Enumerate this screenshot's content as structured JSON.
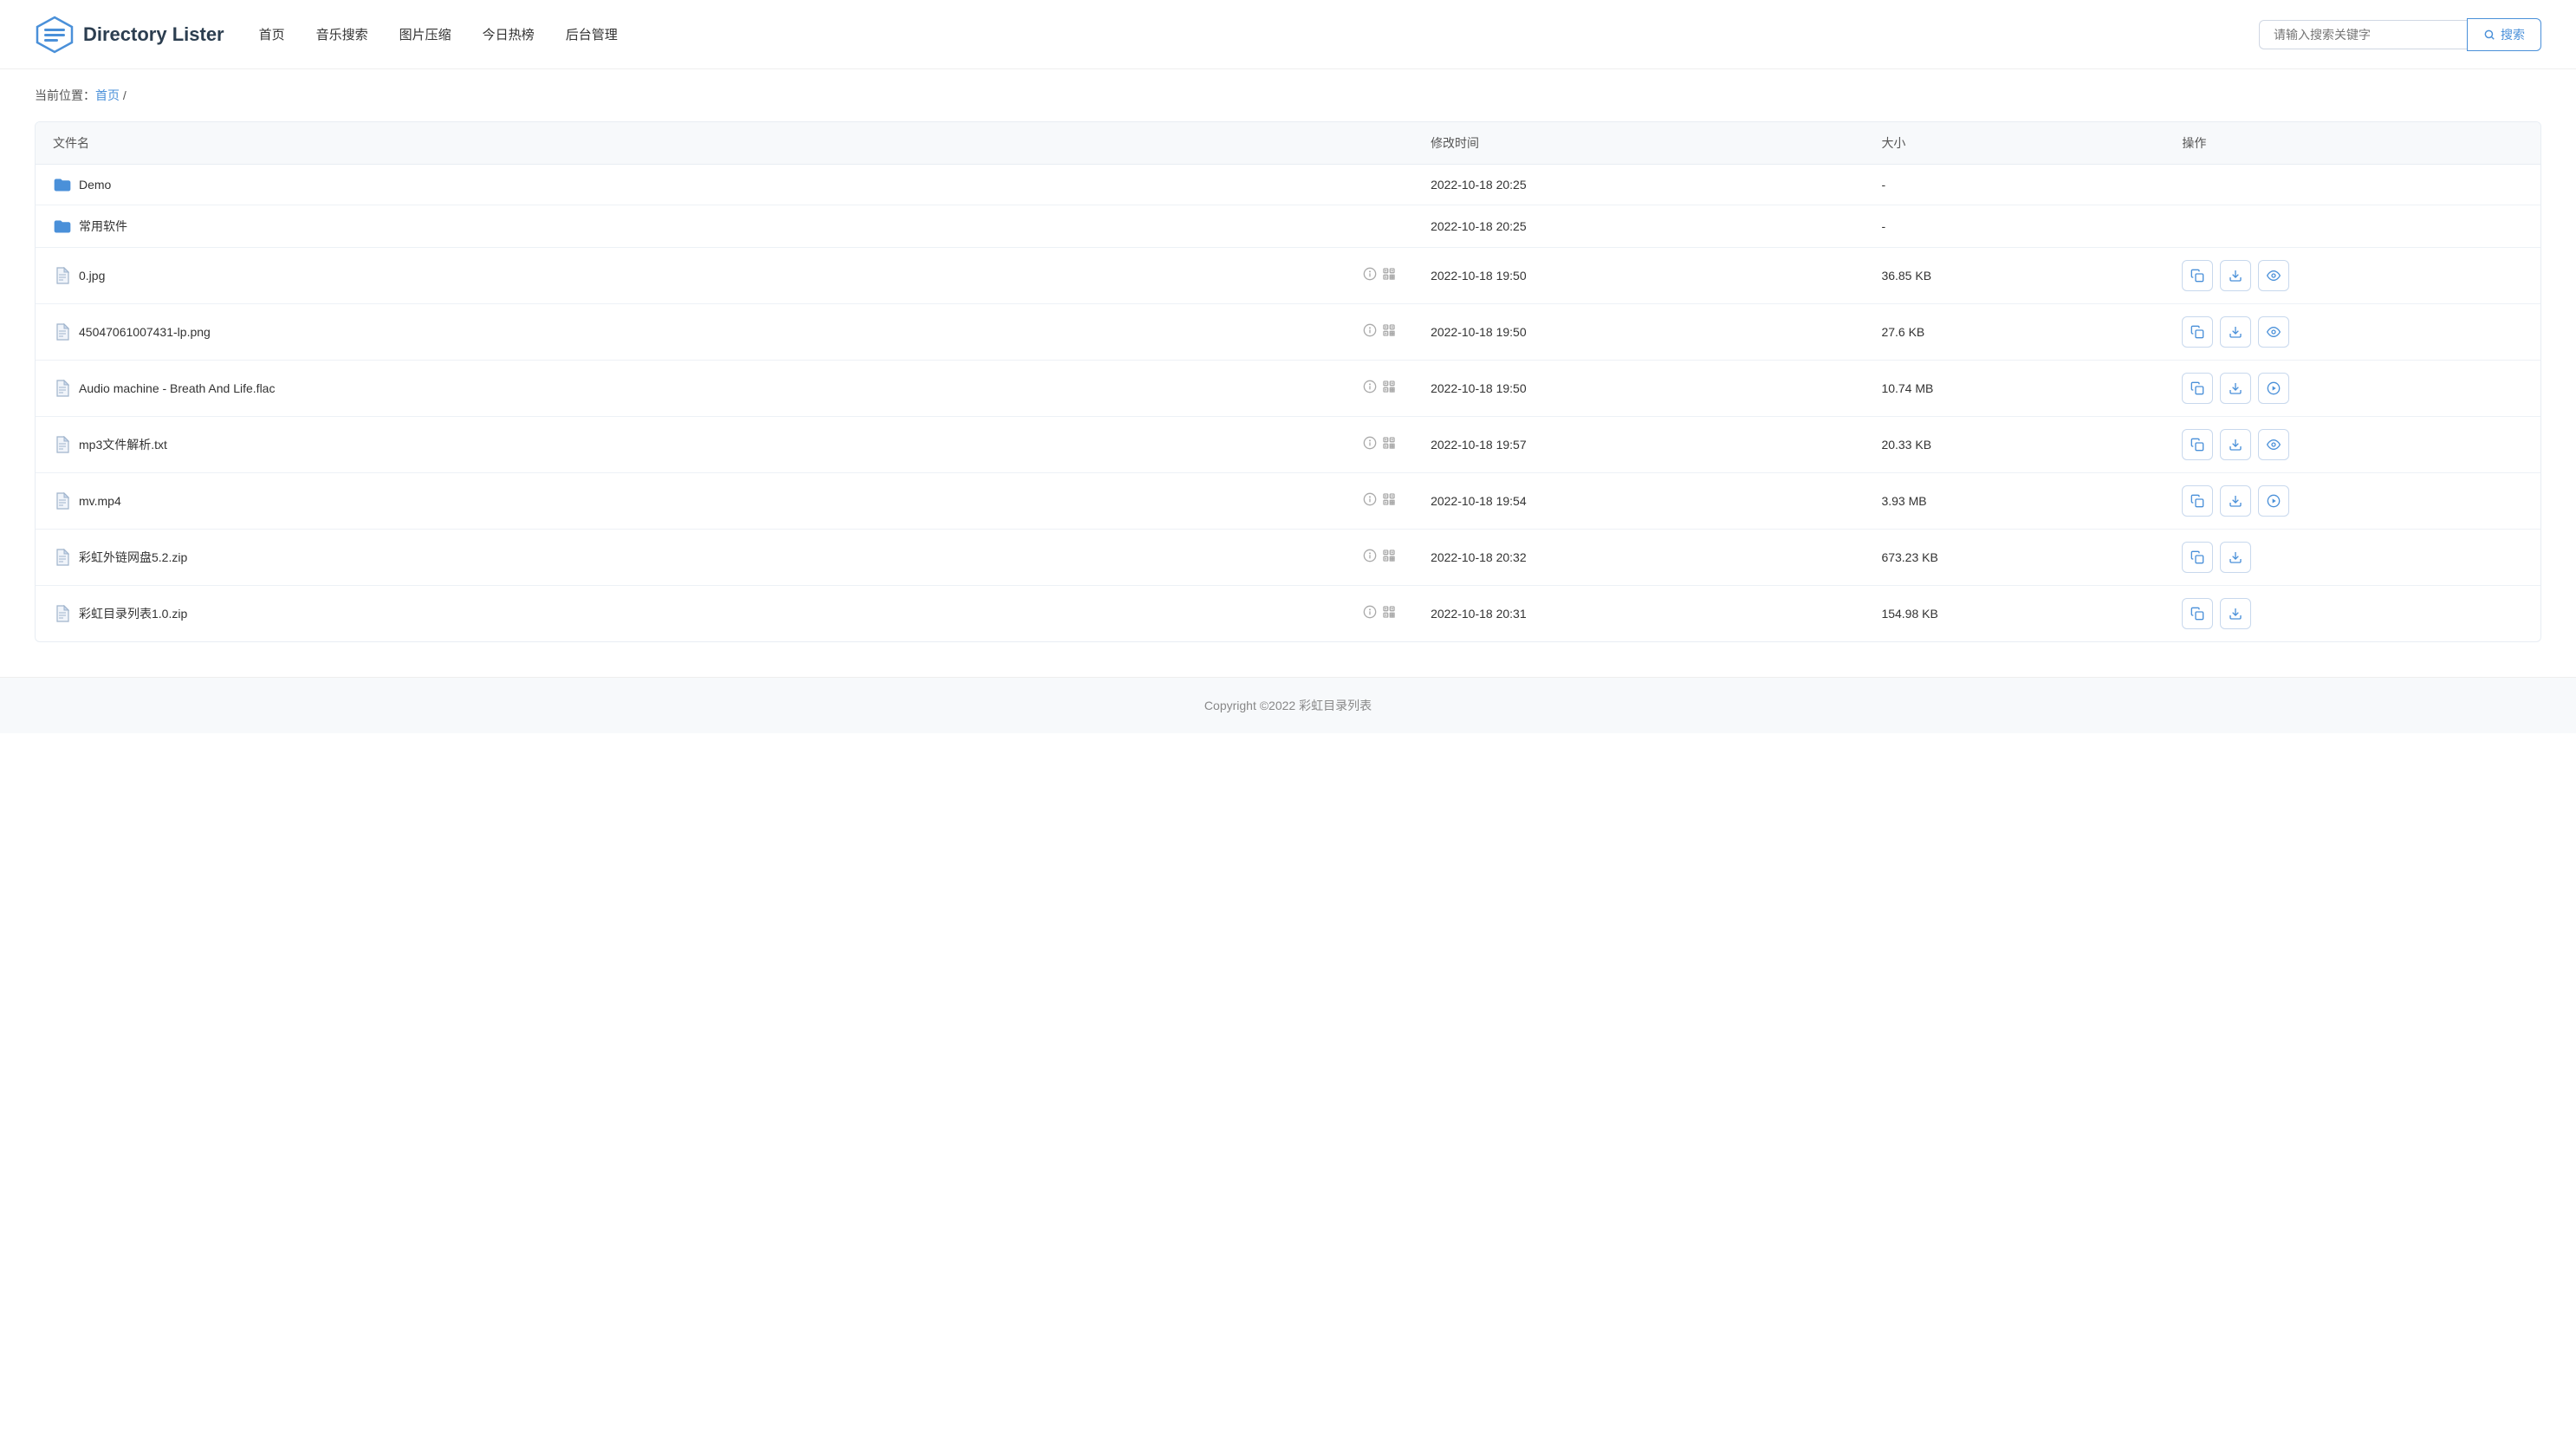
{
  "header": {
    "logo_text": "Directory Lister",
    "nav": [
      {
        "label": "首页",
        "key": "home"
      },
      {
        "label": "音乐搜索",
        "key": "music"
      },
      {
        "label": "图片压缩",
        "key": "image"
      },
      {
        "label": "今日热榜",
        "key": "hot"
      },
      {
        "label": "后台管理",
        "key": "admin"
      }
    ],
    "search_placeholder": "请输入搜索关键字",
    "search_button": "搜索"
  },
  "breadcrumb": {
    "prefix": "当前位置：",
    "home_link": "首页",
    "separator": " /"
  },
  "table": {
    "columns": {
      "name": "文件名",
      "modified": "修改时间",
      "size": "大小",
      "action": "操作"
    },
    "rows": [
      {
        "type": "folder",
        "name": "Demo",
        "modified": "2022-10-18 20:25",
        "size": "-",
        "actions": []
      },
      {
        "type": "folder",
        "name": "常用软件",
        "modified": "2022-10-18 20:25",
        "size": "-",
        "actions": []
      },
      {
        "type": "file",
        "name": "0.jpg",
        "modified": "2022-10-18 19:50",
        "size": "36.85 KB",
        "actions": [
          "copy",
          "download",
          "preview"
        ]
      },
      {
        "type": "file",
        "name": "45047061007431-lp.png",
        "modified": "2022-10-18 19:50",
        "size": "27.6 KB",
        "actions": [
          "copy",
          "download",
          "preview"
        ]
      },
      {
        "type": "file",
        "name": "Audio machine - Breath And Life.flac",
        "modified": "2022-10-18 19:50",
        "size": "10.74 MB",
        "actions": [
          "copy",
          "download",
          "play"
        ]
      },
      {
        "type": "file",
        "name": "mp3文件解析.txt",
        "modified": "2022-10-18 19:57",
        "size": "20.33 KB",
        "actions": [
          "copy",
          "download",
          "preview"
        ]
      },
      {
        "type": "file",
        "name": "mv.mp4",
        "modified": "2022-10-18 19:54",
        "size": "3.93 MB",
        "actions": [
          "copy",
          "download",
          "play"
        ]
      },
      {
        "type": "file",
        "name": "彩虹外链网盘5.2.zip",
        "modified": "2022-10-18 20:32",
        "size": "673.23 KB",
        "actions": [
          "copy",
          "download"
        ]
      },
      {
        "type": "file",
        "name": "彩虹目录列表1.0.zip",
        "modified": "2022-10-18 20:31",
        "size": "154.98 KB",
        "actions": [
          "copy",
          "download"
        ]
      }
    ]
  },
  "footer": {
    "text": "Copyright ©2022 彩虹目录列表"
  }
}
